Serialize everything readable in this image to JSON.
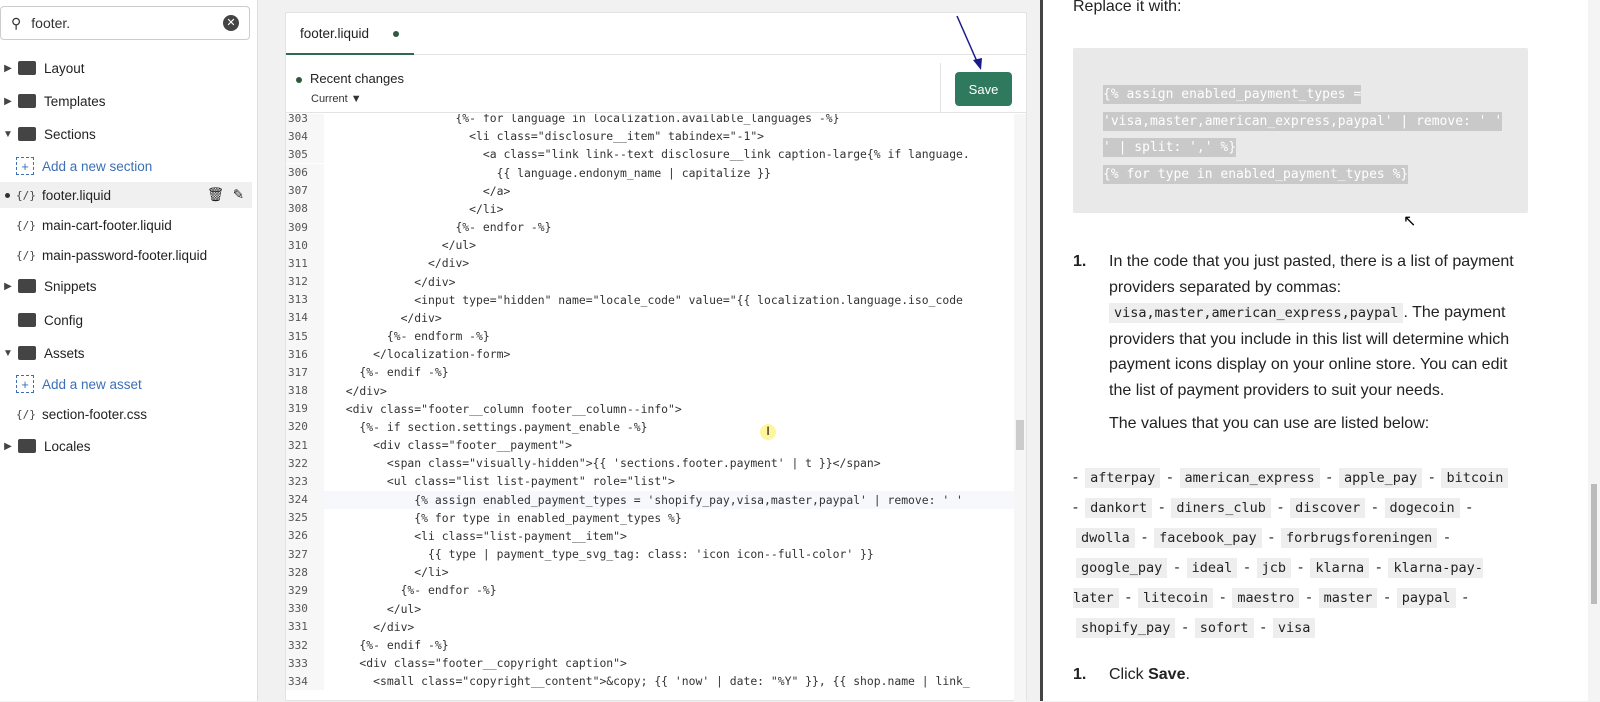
{
  "sidebar": {
    "search": "footer.",
    "items": [
      {
        "type": "folder",
        "label": "Layout",
        "open": false
      },
      {
        "type": "folder",
        "label": "Templates",
        "open": false
      },
      {
        "type": "folder",
        "label": "Sections",
        "open": true
      },
      {
        "type": "add",
        "label": "Add a new section"
      },
      {
        "type": "file",
        "label": "footer.liquid",
        "selected": true
      },
      {
        "type": "file",
        "label": "main-cart-footer.liquid"
      },
      {
        "type": "file",
        "label": "main-password-footer.liquid"
      },
      {
        "type": "folder",
        "label": "Snippets",
        "open": false
      },
      {
        "type": "folder",
        "label": "Config",
        "open": null
      },
      {
        "type": "folder",
        "label": "Assets",
        "open": true
      },
      {
        "type": "add",
        "label": "Add a new asset"
      },
      {
        "type": "file",
        "label": "section-footer.css"
      },
      {
        "type": "folder",
        "label": "Locales",
        "open": false
      }
    ]
  },
  "editor": {
    "tab": "footer.liquid",
    "recent_changes": "Recent changes",
    "version": "Current",
    "save_label": "Save",
    "active_line": 324,
    "lines": [
      [
        303,
        "                  {%- for language in localization.available_languages -%}"
      ],
      [
        304,
        "                    <li class=\"disclosure__item\" tabindex=\"-1\">"
      ],
      [
        305,
        "                      <a class=\"link link--text disclosure__link caption-large{% if language."
      ],
      [
        306,
        "                        {{ language.endonym_name | capitalize }}"
      ],
      [
        307,
        "                      </a>"
      ],
      [
        308,
        "                    </li>"
      ],
      [
        309,
        "                  {%- endfor -%}"
      ],
      [
        310,
        "                </ul>"
      ],
      [
        311,
        "              </div>"
      ],
      [
        312,
        "            </div>"
      ],
      [
        313,
        "            <input type=\"hidden\" name=\"locale_code\" value=\"{{ localization.language.iso_code"
      ],
      [
        314,
        "          </div>"
      ],
      [
        315,
        "        {%- endform -%}"
      ],
      [
        316,
        "      </localization-form>"
      ],
      [
        317,
        "    {%- endif -%}"
      ],
      [
        318,
        "  </div>"
      ],
      [
        319,
        "  <div class=\"footer__column footer__column--info\">"
      ],
      [
        320,
        "    {%- if section.settings.payment_enable -%}"
      ],
      [
        321,
        "      <div class=\"footer__payment\">"
      ],
      [
        322,
        "        <span class=\"visually-hidden\">{{ 'sections.footer.payment' | t }}</span>"
      ],
      [
        323,
        "        <ul class=\"list list-payment\" role=\"list\">"
      ],
      [
        324,
        "            {% assign enabled_payment_types = 'shopify_pay,visa,master,paypal' | remove: ' '"
      ],
      [
        325,
        "            {% for type in enabled_payment_types %}"
      ],
      [
        326,
        "            <li class=\"list-payment__item\">"
      ],
      [
        327,
        "              {{ type | payment_type_svg_tag: class: 'icon icon--full-color' }}"
      ],
      [
        328,
        "            </li>"
      ],
      [
        329,
        "          {%- endfor -%}"
      ],
      [
        330,
        "        </ul>"
      ],
      [
        331,
        "      </div>"
      ],
      [
        332,
        "    {%- endif -%}"
      ],
      [
        333,
        "    <div class=\"footer__copyright caption\">"
      ],
      [
        334,
        "      <small class=\"copyright__content\">&copy; {{ 'now' | date: \"%Y\" }}, {{ shop.name | link_"
      ]
    ]
  },
  "doc": {
    "replace_heading": "Replace it with:",
    "code": [
      "{% assign enabled_payment_types =",
      "'visa,master,american_express,paypal' | remove: ' '",
      "' | split: ',' %}",
      "{% for type in enabled_payment_types %}"
    ],
    "step1_num": "1.",
    "step1_a": "In the code that you just pasted, there is a list of payment providers separated by commas:",
    "step1_code": "visa,master,american_express,paypal",
    "step1_b": ". The payment providers that you include in this list will determine which payment icons display on your online store. You can edit the list of payment providers to suit your needs.",
    "step1_c": "The values that you can use are listed below:",
    "values": [
      "afterpay",
      "american_express",
      "apple_pay",
      "bitcoin",
      "dankort",
      "diners_club",
      "discover",
      "dogecoin",
      "dwolla",
      "facebook_pay",
      "forbrugsforeningen",
      "google_pay",
      "ideal",
      "jcb",
      "klarna",
      "klarna-pay-later",
      "litecoin",
      "maestro",
      "master",
      "paypal",
      "shopify_pay",
      "sofort",
      "visa"
    ],
    "step2_num": "1.",
    "step2_a": "Click ",
    "step2_bold": "Save",
    "step2_end": "."
  },
  "colors": {
    "save": "#2f7a5e",
    "accent": "#3b6fb6"
  }
}
